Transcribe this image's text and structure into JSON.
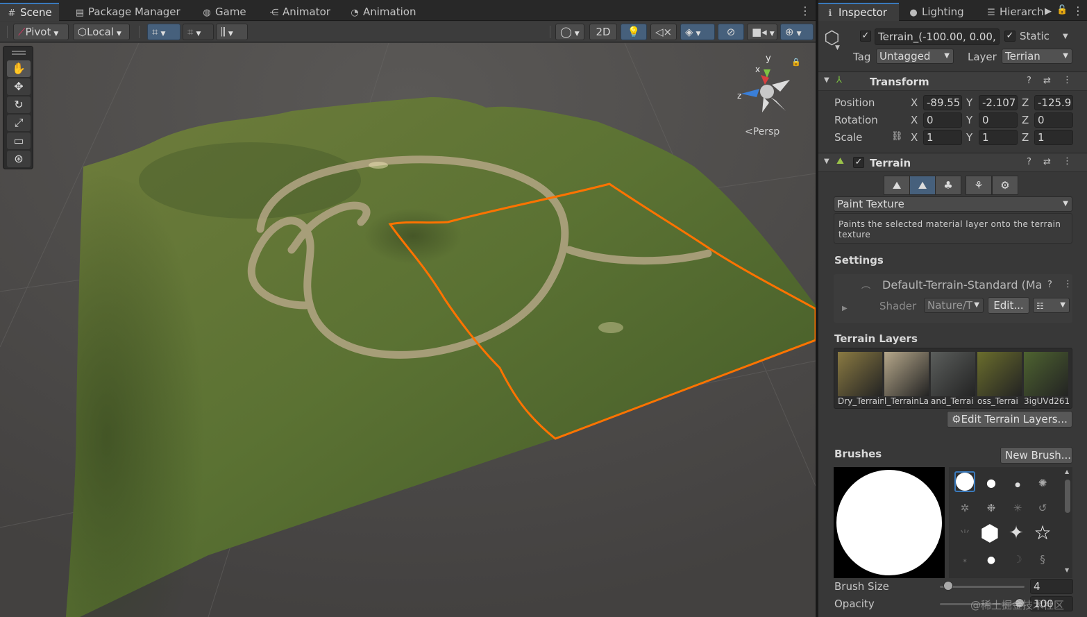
{
  "scene_tabs": [
    {
      "icon": "grid-icon",
      "label": "Scene"
    },
    {
      "icon": "package-icon",
      "label": "Package Manager"
    },
    {
      "icon": "gamepad-icon",
      "label": "Game"
    },
    {
      "icon": "animator-icon",
      "label": "Animator"
    },
    {
      "icon": "animation-icon",
      "label": "Animation"
    }
  ],
  "scene_toolbar": {
    "pivot": "Pivot",
    "local": "Local",
    "mode_2d": "2D",
    "view_label": "Persp",
    "gizmo_y": "y",
    "gizmo_x": "x",
    "gizmo_z": "z"
  },
  "tools": [
    "hand-tool",
    "move-tool",
    "rotate-tool",
    "scale-tool",
    "rect-tool",
    "transform-tool"
  ],
  "inspector_tabs": [
    {
      "icon": "info-icon",
      "label": "Inspector"
    },
    {
      "icon": "lightbulb-icon",
      "label": "Lighting"
    },
    {
      "icon": "list-icon",
      "label": "Hierarch"
    }
  ],
  "object": {
    "name": "Terrain_(-100.00, 0.00,",
    "active": true,
    "static_label": "Static",
    "static": true,
    "tag_label": "Tag",
    "tag": "Untagged",
    "layer_label": "Layer",
    "layer": "Terrian"
  },
  "transform": {
    "title": "Transform",
    "position_label": "Position",
    "rotation_label": "Rotation",
    "scale_label": "Scale",
    "x": "X",
    "y": "Y",
    "z": "Z",
    "position": [
      "-89.55",
      "-2.107",
      "-125.9"
    ],
    "rotation": [
      "0",
      "0",
      "0"
    ],
    "scale": [
      "1",
      "1",
      "1"
    ]
  },
  "terrain": {
    "title": "Terrain",
    "enabled": true,
    "mode": "Paint Texture",
    "help": "Paints the selected material layer onto the terrain texture",
    "settings_title": "Settings",
    "material_name": "Default-Terrain-Standard (Ma",
    "shader_label": "Shader",
    "shader_value": "Nature/T",
    "edit_button": "Edit...",
    "layers_title": "Terrain Layers",
    "layers": [
      {
        "name": "Dry_Terrain",
        "color": "#8a7a42"
      },
      {
        "name": "l_TerrainLa",
        "color": "#b5a78a"
      },
      {
        "name": "and_Terrai",
        "color": "#5b5e5c"
      },
      {
        "name": "oss_Terrai",
        "color": "#6a6d2c"
      },
      {
        "name": "3igUVd261",
        "color": "#4e6330"
      }
    ],
    "edit_layers_button": "Edit Terrain Layers...",
    "brushes_title": "Brushes",
    "new_brush_button": "New Brush...",
    "brush_size_label": "Brush Size",
    "brush_size": "4",
    "brush_size_fraction": 0.04,
    "opacity_label": "Opacity",
    "opacity": "100",
    "opacity_fraction": 1.0
  },
  "watermark": "@稀土掘金技术社区",
  "colors": {
    "accent_blue": "#46607c",
    "selection_outline": "#ff7300",
    "terrain_green": "#5b7a32"
  }
}
